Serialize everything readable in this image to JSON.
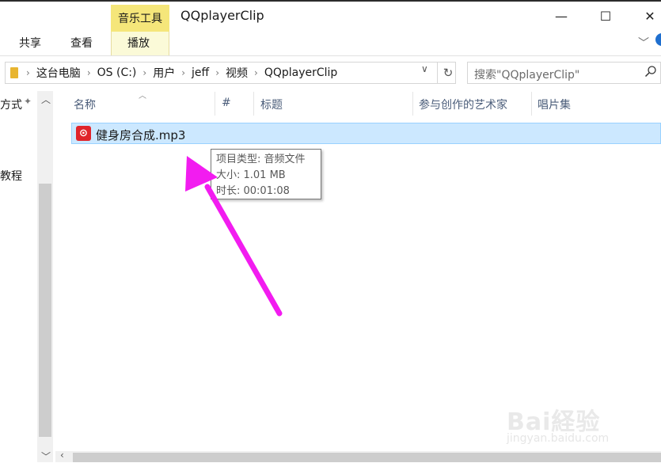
{
  "window": {
    "title": "QQplayerClip",
    "minimize": "—",
    "maximize": "☐",
    "close": "✕"
  },
  "ribbon": {
    "context_tab": "音乐工具",
    "tabs": [
      "共享",
      "查看",
      "播放"
    ],
    "expand": "﹀"
  },
  "address": {
    "crumbs": [
      "这台电脑",
      "OS (C:)",
      "用户",
      "jeff",
      "视频",
      "QQplayerClip"
    ],
    "separator": "›",
    "dropdown": "∨",
    "refresh": "↻"
  },
  "search": {
    "placeholder": "搜索\"QQplayerClip\"",
    "icon": "search-icon"
  },
  "nav": {
    "items": [
      "方式",
      "教程"
    ],
    "pin": "✦"
  },
  "columns": [
    "名称",
    "#",
    "标题",
    "参与创作的艺术家",
    "唱片集"
  ],
  "files": [
    {
      "name": "健身房合成.mp3",
      "icon_text": "⊙"
    }
  ],
  "tooltip": {
    "lines": [
      "项目类型: 音频文件",
      "大小: 1.01 MB",
      "时长: 00:01:08"
    ]
  },
  "watermark": {
    "brand": "Bai経验",
    "url": "jingyan.baidu.com"
  },
  "colors": {
    "context_tab": "#f5e67a",
    "selection": "#cce8ff",
    "arrow": "#f21cf0",
    "file_icon": "#e0242b"
  }
}
